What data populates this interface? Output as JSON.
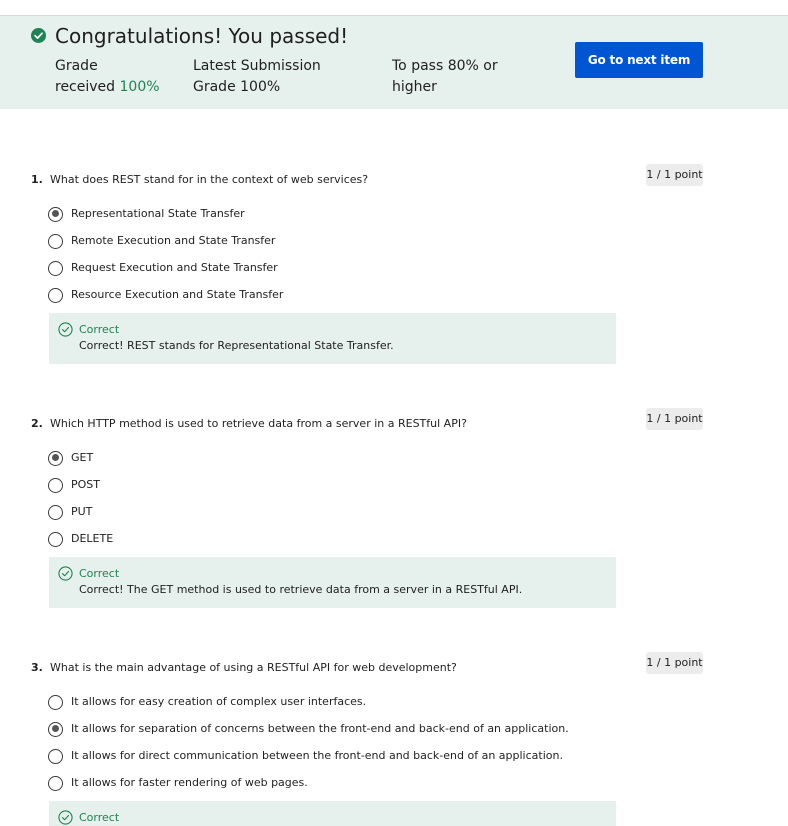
{
  "banner": {
    "title": "Congratulations! You passed!",
    "grade_label_line1": "Grade",
    "grade_label_line2": "received",
    "grade_value": "100%",
    "latest_label_line1": "Latest Submission",
    "latest_label_line2": "Grade",
    "latest_value": "100%",
    "pass_label_line1": "To pass 80% or",
    "pass_label_line2": "higher",
    "next_button": "Go to next item",
    "status_icon": "check-circle-icon",
    "accent_color": "#1f8354"
  },
  "questions": [
    {
      "number": "1.",
      "text": "What does REST stand for in the context of web services?",
      "points": "1 / 1 point",
      "options": [
        {
          "label": "Representational State Transfer",
          "selected": true
        },
        {
          "label": "Remote Execution and State Transfer",
          "selected": false
        },
        {
          "label": "Request Execution and State Transfer",
          "selected": false
        },
        {
          "label": "Resource Execution and State Transfer",
          "selected": false
        }
      ],
      "feedback_title": "Correct",
      "feedback_text": "Correct! REST stands for Representational State Transfer."
    },
    {
      "number": "2.",
      "text": "Which HTTP method is used to retrieve data from a server in a RESTful API?",
      "points": "1 / 1 point",
      "options": [
        {
          "label": "GET",
          "selected": true
        },
        {
          "label": "POST",
          "selected": false
        },
        {
          "label": "PUT",
          "selected": false
        },
        {
          "label": "DELETE",
          "selected": false
        }
      ],
      "feedback_title": "Correct",
      "feedback_text": "Correct! The GET method is used to retrieve data from a server in a RESTful API."
    },
    {
      "number": "3.",
      "text": "What is the main advantage of using a RESTful API for web development?",
      "points": "1 / 1 point",
      "options": [
        {
          "label": "It allows for easy creation of complex user interfaces.",
          "selected": false
        },
        {
          "label": "It allows for separation of concerns between the front-end and back-end of an application.",
          "selected": true
        },
        {
          "label": "It allows for direct communication between the front-end and back-end of an application.",
          "selected": false
        },
        {
          "label": "It allows for faster rendering of web pages.",
          "selected": false
        }
      ],
      "feedback_title": "Correct",
      "feedback_text": ""
    }
  ],
  "colors": {
    "banner_bg": "#e6f0ec",
    "button_bg": "#0056d2",
    "correct_green": "#1f8354"
  }
}
